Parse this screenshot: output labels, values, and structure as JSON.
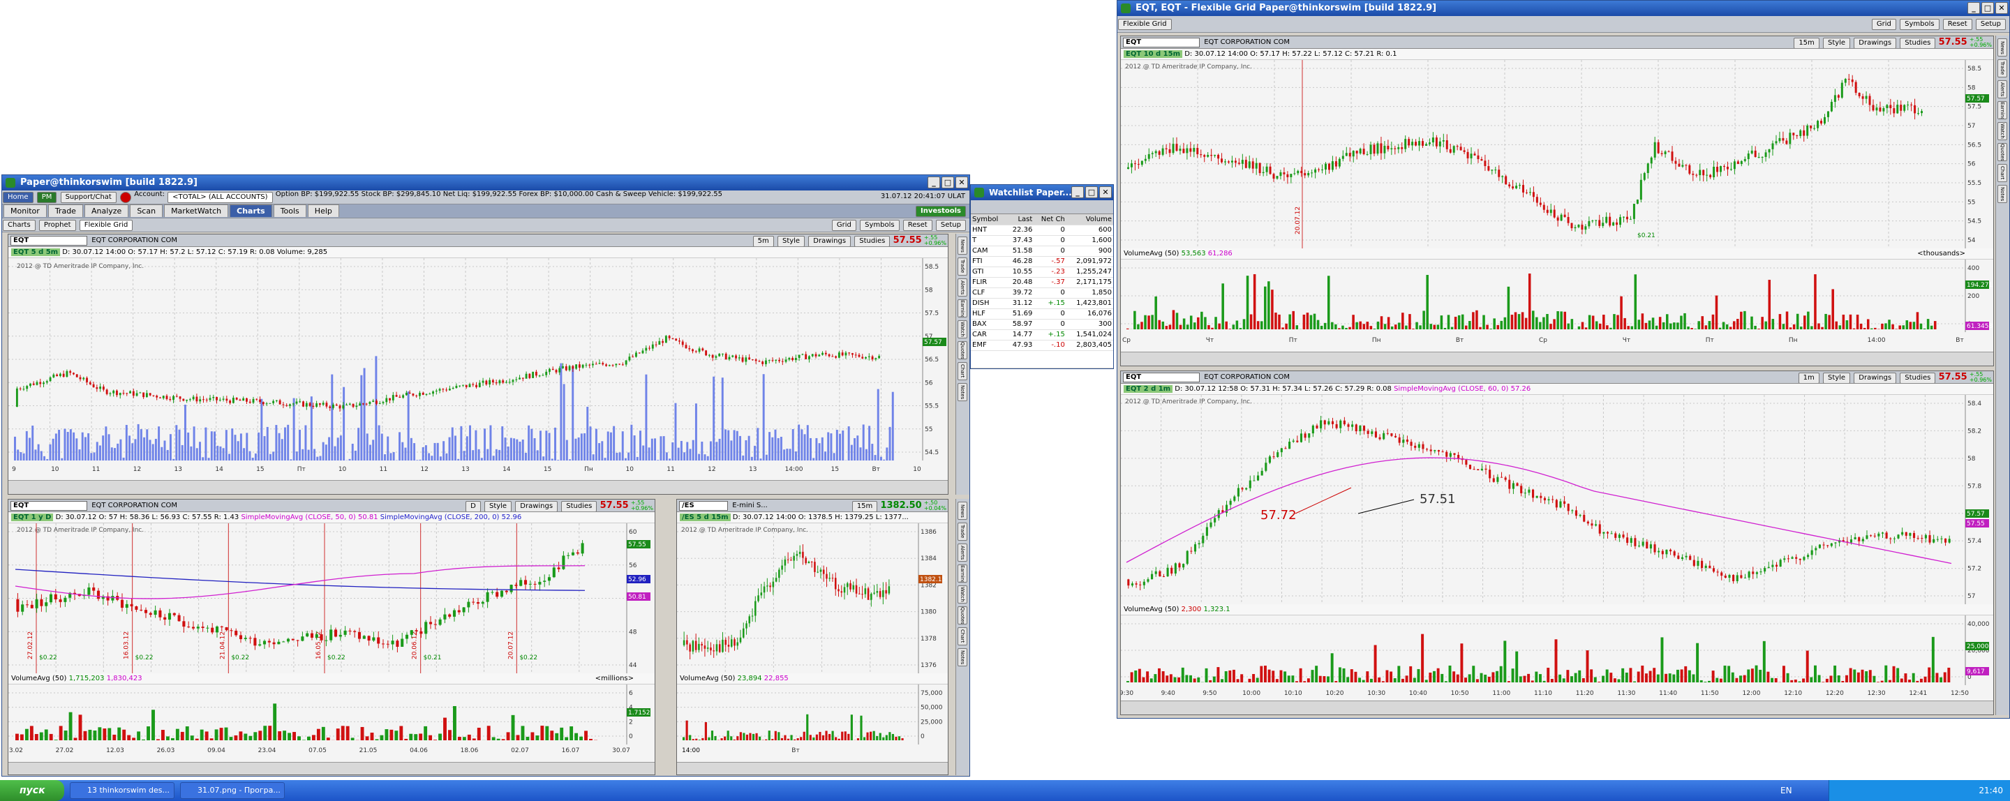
{
  "window_left": {
    "title": "Paper@thinkorswim [build 1822.9]",
    "toolbar": {
      "home": "Home",
      "pm": "PM",
      "support": "Support/Chat",
      "account_label": "Account:",
      "account_value": "<TOTAL> (ALL ACCOUNTS)",
      "option_bp": "Option BP:",
      "option_bp_val": "$199,922.55",
      "stock_bp": "Stock BP:",
      "stock_bp_val": "$299,845.10",
      "net_liq": "Net Liq:",
      "net_liq_val": "$199,922.55",
      "forex_bp": "Forex BP:",
      "forex_bp_val": "$10,000.00",
      "cash": "Cash & Sweep Vehicle:",
      "cash_val": "$199,922.55",
      "datetime": "31.07.12 20:41:07 ULAT"
    },
    "tabs": [
      "Monitor",
      "Trade",
      "Analyze",
      "Scan",
      "MarketWatch",
      "Charts",
      "Tools",
      "Help"
    ],
    "active_tab": "Charts",
    "subtabs": [
      "Charts",
      "Prophet",
      "Flexible Grid"
    ],
    "investools": "Investools",
    "right_buttons": [
      "Grid",
      "Symbols",
      "Reset",
      "Setup"
    ],
    "side_buttons": [
      "News",
      "Trade",
      "Alerts",
      "Earnings",
      "Watch",
      "Quotes",
      "Chart",
      "Notes"
    ]
  },
  "chart_top_left": {
    "symbol": "EQT",
    "company": "EQT CORPORATION COM",
    "timeframe": "5m",
    "menu": [
      "Style",
      "Drawings",
      "Studies"
    ],
    "price": "57.55",
    "change_top": "+.55",
    "change_bot": "+0.96%",
    "info_tk": "EQT 5 d 5m",
    "info": "D: 30.07.12 14:00  O: 57.17  H: 57.2  L: 57.12  C: 57.19  R: 0.08  Volume: 9,285",
    "copyright": "2012 @ TD Ameritrade IP Company, Inc.",
    "y_ticks": [
      "58.5",
      "58",
      "57.5",
      "57",
      "56.5",
      "56",
      "55.5",
      "55",
      "54.5"
    ],
    "x_ticks": [
      "9",
      "10",
      "11",
      "12",
      "13",
      "14",
      "15",
      "Пт",
      "10",
      "11",
      "12",
      "13",
      "14",
      "15",
      "Пн",
      "10",
      "11",
      "12",
      "13",
      "14:00",
      "15",
      "Вт",
      "10"
    ],
    "last_tag": "57.57"
  },
  "chart_mid_left": {
    "symbol": "EQT",
    "company": "EQT CORPORATION COM",
    "timeframe": "D",
    "menu": [
      "Style",
      "Drawings",
      "Studies"
    ],
    "price": "57.55",
    "change_top": "+.55",
    "change_bot": "+0.96%",
    "info_tk": "EQT 1 y D",
    "info": "D: 30.07.12  O: 57  H: 58.36  L: 56.93  C: 57.55  R: 1.43",
    "sma1": "SimpleMovingAvg (CLOSE, 50, 0)",
    "sma1_val": "50.81",
    "sma2": "SimpleMovingAvg (CLOSE, 200, 0)",
    "sma2_val": "52.96",
    "copyright": "2012 @ TD Ameritrade IP Company, Inc.",
    "y_ticks": [
      "60",
      "56",
      "52",
      "48",
      "44"
    ],
    "tags": [
      "57.55",
      "52.96",
      "50.81"
    ],
    "date_marks": [
      "27.02.12",
      "16.03.12",
      "21.04.12",
      "16.05.12",
      "20.06.12",
      "20.07.12"
    ],
    "dividends": [
      "$0.22",
      "$0.22",
      "$0.22",
      "$0.22",
      "$0.21",
      "$0.22"
    ],
    "vol_label": "VolumeAvg (50)",
    "vol_v1": "1,715,203",
    "vol_v2": "1,830,423",
    "vol_units": "<millions>",
    "vol_y": [
      "6",
      "4",
      "2",
      "0"
    ],
    "vol_tag": "1.7152",
    "x_ticks": [
      "13.02",
      "27.02",
      "12.03",
      "26.03",
      "09.04",
      "23.04",
      "07.05",
      "21.05",
      "04.06",
      "18.06",
      "02.07",
      "16.07",
      "30.07"
    ]
  },
  "chart_es": {
    "symbol": "/ES",
    "company": "E-mini S...",
    "timeframe": "15m",
    "price": "1382.50",
    "change_top": "+.50",
    "change_bot": "+0.04%",
    "info_tk": "/ES 5 d 15m",
    "info": "D: 30.07.12 14:00  O: 1378.5  H: 1379.25  L: 1377...",
    "copyright": "2012 @ TD Ameritrade IP Company, Inc.",
    "y_ticks": [
      "1386",
      "1384",
      "1382",
      "1380",
      "1378",
      "1376"
    ],
    "tag": "1382.15",
    "vol_label": "VolumeAvg (50)",
    "vol_v1": "23,894",
    "vol_v2": "22,855",
    "vol_y": [
      "75,000",
      "50,000",
      "25,000",
      "0"
    ],
    "x_ticks": [
      "14:00",
      "Вт"
    ]
  },
  "watchlist": {
    "title": "Watchlist Paper...",
    "columns": [
      "Symbol",
      "Last",
      "Net Ch",
      "Volume"
    ],
    "rows": [
      {
        "sym": "HNT",
        "last": "22.36",
        "net": "0",
        "vol": "600",
        "neg": false
      },
      {
        "sym": "T",
        "last": "37.43",
        "net": "0",
        "vol": "1,600",
        "neg": false
      },
      {
        "sym": "CAM",
        "last": "51.58",
        "net": "0",
        "vol": "900",
        "neg": false
      },
      {
        "sym": "FTI",
        "last": "46.28",
        "net": "-.57",
        "vol": "2,091,972",
        "neg": true
      },
      {
        "sym": "GTI",
        "last": "10.55",
        "net": "-.23",
        "vol": "1,255,247",
        "neg": true
      },
      {
        "sym": "FLIR",
        "last": "20.48",
        "net": "-.37",
        "vol": "2,171,175",
        "neg": true
      },
      {
        "sym": "CLF",
        "last": "39.72",
        "net": "0",
        "vol": "1,850",
        "neg": false
      },
      {
        "sym": "DISH",
        "last": "31.12",
        "net": "+.15",
        "vol": "1,423,801",
        "neg": false
      },
      {
        "sym": "HLF",
        "last": "51.69",
        "net": "0",
        "vol": "16,076",
        "neg": false
      },
      {
        "sym": "BAX",
        "last": "58.97",
        "net": "0",
        "vol": "300",
        "neg": false
      },
      {
        "sym": "CAR",
        "last": "14.77",
        "net": "+.15",
        "vol": "1,541,024",
        "neg": false
      },
      {
        "sym": "EMF",
        "last": "47.93",
        "net": "-.10",
        "vol": "2,803,405",
        "neg": true
      }
    ]
  },
  "window_right": {
    "title": "EQT, EQT - Flexible Grid Paper@thinkorswim [build 1822.9]",
    "subtab": "Flexible Grid",
    "right_buttons": [
      "Grid",
      "Symbols",
      "Reset",
      "Setup"
    ]
  },
  "chart_top_right": {
    "symbol": "EQT",
    "company": "EQT CORPORATION COM",
    "timeframe": "15m",
    "menu": [
      "Style",
      "Drawings",
      "Studies"
    ],
    "price": "57.55",
    "change_top": "+.55",
    "change_bot": "+0.96%",
    "info_tk": "EQT 10 d 15m",
    "info": "D: 30.07.12 14:00  O: 57.17  H: 57.22  L: 57.12  C: 57.21  R: 0.1",
    "copyright": "2012 @ TD Ameritrade IP Company, Inc.",
    "y_ticks": [
      "58.5",
      "58",
      "57.5",
      "57",
      "56.5",
      "56",
      "55.5",
      "55",
      "54.5",
      "54"
    ],
    "tag": "57.57",
    "date_mark": "20.07.12",
    "div_label": "$0.21",
    "vol_label": "VolumeAvg (50)",
    "vol_v1": "53,563",
    "vol_v2": "61,286",
    "vol_units": "<thousands>",
    "vol_y": [
      "400",
      "200",
      "0"
    ],
    "vol_tag1": "194.271",
    "vol_tag2": "61.3458",
    "x_ticks": [
      "Ср",
      "Чт",
      "Пт",
      "Пн",
      "Вт",
      "Ср",
      "Чт",
      "Пт",
      "Пн",
      "14:00",
      "Вт"
    ]
  },
  "chart_bot_right": {
    "symbol": "EQT",
    "company": "EQT CORPORATION COM",
    "timeframe": "1m",
    "menu": [
      "Style",
      "Drawings",
      "Studies"
    ],
    "price": "57.55",
    "change_top": "+.55",
    "change_bot": "+0.96%",
    "info_tk": "EQT 2 d 1m",
    "info": "D: 30.07.12 12:58  O: 57.31  H: 57.34  L: 57.26  C: 57.29  R: 0.08",
    "sma": "SimpleMovingAvg (CLOSE, 60, 0)",
    "sma_val": "57.26",
    "copyright": "2012 @ TD Ameritrade IP Company, Inc.",
    "y_ticks": [
      "58.4",
      "58.2",
      "58",
      "57.8",
      "57.6",
      "57.4",
      "57.2",
      "57"
    ],
    "tags": [
      "57.57",
      "57.55"
    ],
    "annot1": "57.72",
    "annot2": "57.51",
    "vol_label": "VolumeAvg (50)",
    "vol_v1": "2,300",
    "vol_v2": "1,323.1",
    "vol_y": [
      "40,000",
      "20,000",
      "0"
    ],
    "vol_tag1": "25,000",
    "vol_tag2": "9,617",
    "x_ticks": [
      "9:30",
      "9:40",
      "9:50",
      "10:00",
      "10:10",
      "10:20",
      "10:30",
      "10:40",
      "10:50",
      "11:00",
      "11:10",
      "11:20",
      "11:30",
      "11:40",
      "11:50",
      "12:00",
      "12:10",
      "12:20",
      "12:30",
      "12:41",
      "12:50"
    ]
  },
  "taskbar": {
    "start": "пуск",
    "tasks": [
      "13 thinkorswim des...",
      "31.07.png - Програ..."
    ],
    "lang": "EN",
    "clock": "21:40"
  },
  "colors": {
    "up": "#1a9a1a",
    "down": "#d01010",
    "volume_blue": "#6f83e8",
    "sma": "#d020d0",
    "sma200": "#2020c0",
    "price_red": "#cc0000"
  }
}
